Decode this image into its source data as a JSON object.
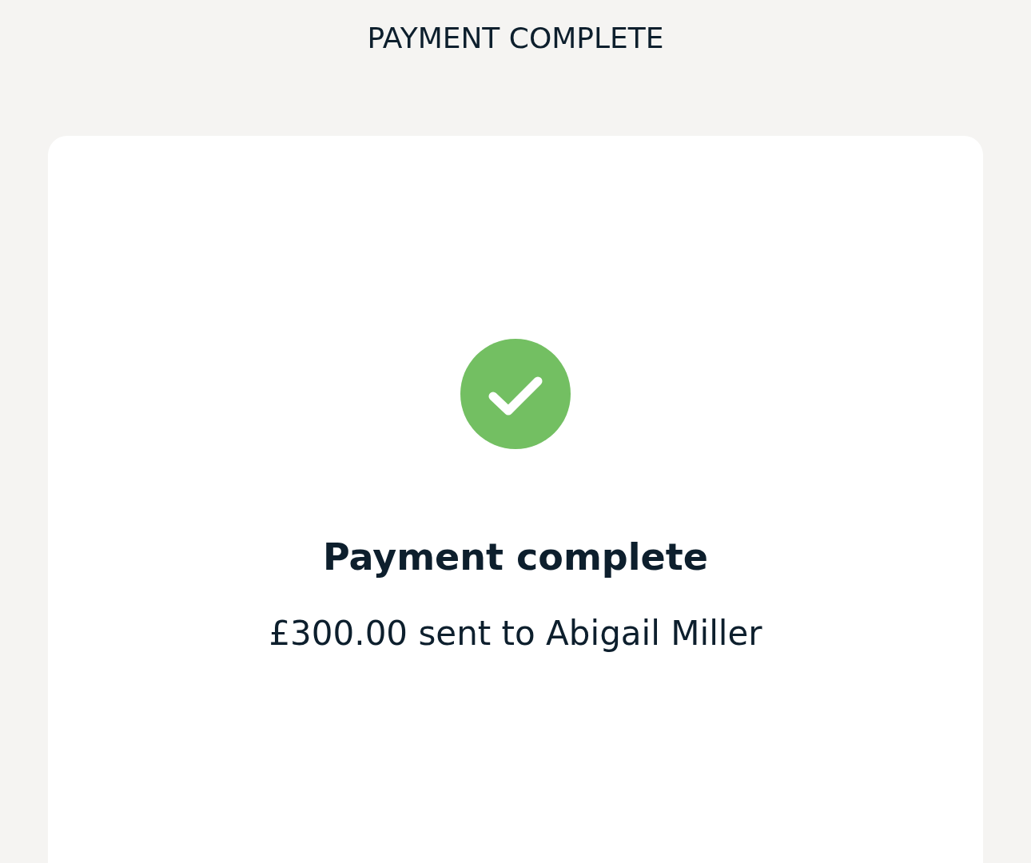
{
  "header": {
    "title": "PAYMENT COMPLETE"
  },
  "confirmation": {
    "title": "Payment complete",
    "message": "£300.00 sent to Abigail Miller"
  }
}
